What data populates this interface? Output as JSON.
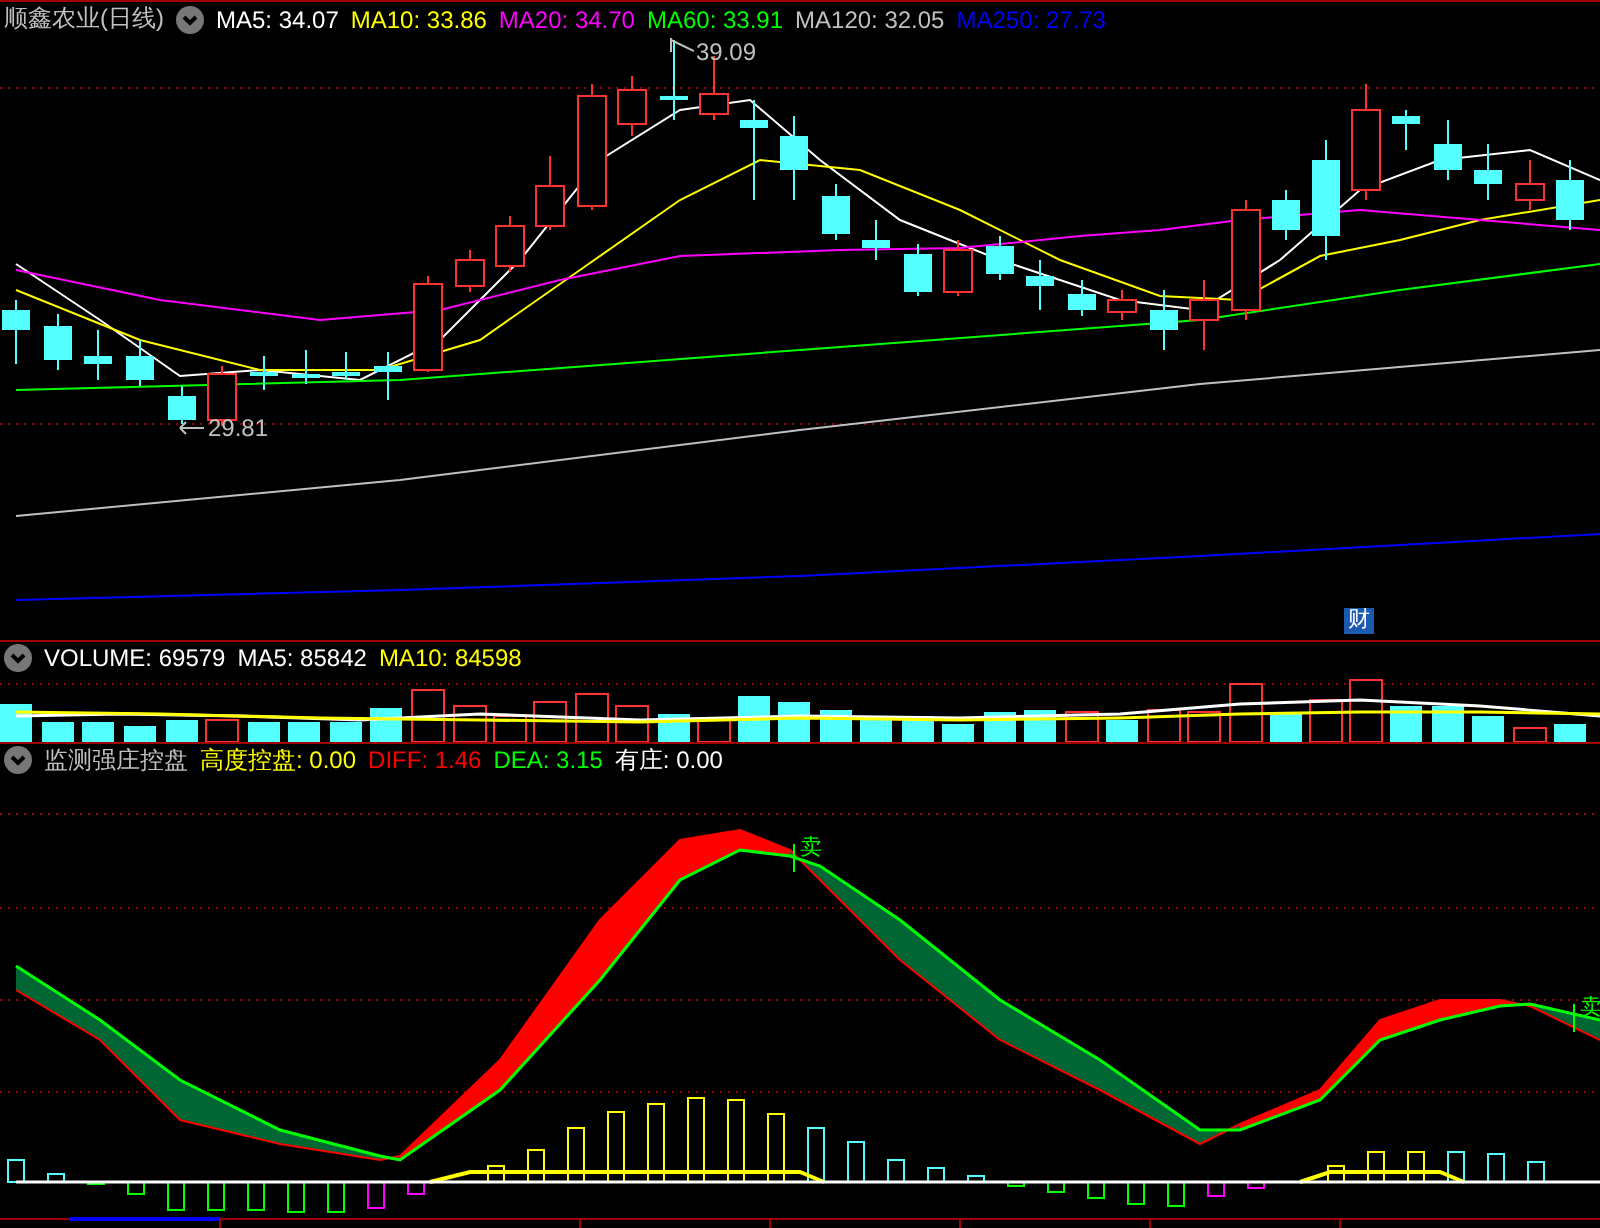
{
  "price_panel": {
    "title": "顺鑫农业(日线)",
    "legend": [
      {
        "label": "MA5: 34.07",
        "color": "#ffffff"
      },
      {
        "label": "MA10: 33.86",
        "color": "#ffff00"
      },
      {
        "label": "MA20: 34.70",
        "color": "#ff00ff"
      },
      {
        "label": "MA60: 33.91",
        "color": "#00ff00"
      },
      {
        "label": "MA120: 32.05",
        "color": "#c0c0c0"
      },
      {
        "label": "MA250: 27.73",
        "color": "#0000ff"
      }
    ],
    "high_label": "39.09",
    "low_label": "29.81",
    "event_badge": "财"
  },
  "volume_panel": {
    "legend": [
      {
        "label": "VOLUME: 69579",
        "color": "#ffffff"
      },
      {
        "label": "MA5: 85842",
        "color": "#ffffff"
      },
      {
        "label": "MA10: 84598",
        "color": "#ffff00"
      }
    ]
  },
  "indicator_panel": {
    "title": "监测强庄控盘",
    "legend": [
      {
        "label": "高度控盘: 0.00",
        "color": "#ffff00"
      },
      {
        "label": "DIFF: 1.46",
        "color": "#ff0000"
      },
      {
        "label": "DEA: 3.15",
        "color": "#00ff00"
      },
      {
        "label": "有庄: 0.00",
        "color": "#ffffff"
      }
    ],
    "signals": [
      "卖",
      "卖"
    ]
  }
}
